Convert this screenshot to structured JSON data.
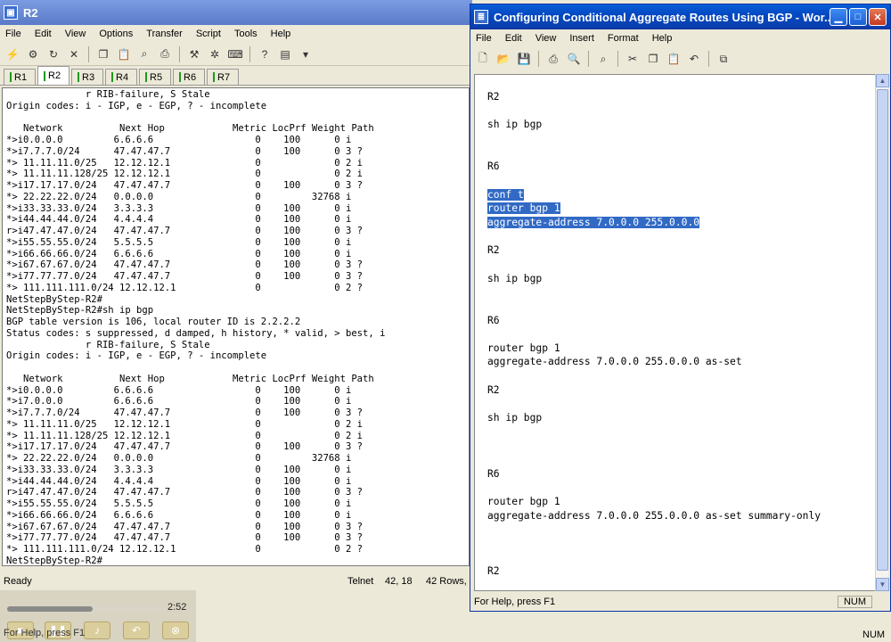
{
  "left_window": {
    "title": "R2",
    "menu": [
      "File",
      "Edit",
      "View",
      "Options",
      "Transfer",
      "Script",
      "Tools",
      "Help"
    ],
    "tabs": [
      "R1",
      "R2",
      "R3",
      "R4",
      "R5",
      "R6",
      "R7"
    ],
    "active_tab": "R2",
    "terminal_lines": [
      "              r RIB-failure, S Stale",
      "Origin codes: i - IGP, e - EGP, ? - incomplete",
      "",
      "   Network          Next Hop            Metric LocPrf Weight Path",
      "*>i0.0.0.0         6.6.6.6                  0    100      0 i",
      "*>i7.7.7.0/24      47.47.47.7               0    100      0 3 ?",
      "*> 11.11.11.0/25   12.12.12.1               0             0 2 i",
      "*> 11.11.11.128/25 12.12.12.1               0             0 2 i",
      "*>i17.17.17.0/24   47.47.47.7               0    100      0 3 ?",
      "*> 22.22.22.0/24   0.0.0.0                  0         32768 i",
      "*>i33.33.33.0/24   3.3.3.3                  0    100      0 i",
      "*>i44.44.44.0/24   4.4.4.4                  0    100      0 i",
      "r>i47.47.47.0/24   47.47.47.7               0    100      0 3 ?",
      "*>i55.55.55.0/24   5.5.5.5                  0    100      0 i",
      "*>i66.66.66.0/24   6.6.6.6                  0    100      0 i",
      "*>i67.67.67.0/24   47.47.47.7               0    100      0 3 ?",
      "*>i77.77.77.0/24   47.47.47.7               0    100      0 3 ?",
      "*> 111.111.111.0/24 12.12.12.1              0             0 2 ?",
      "NetStepByStep-R2#",
      "NetStepByStep-R2#sh ip bgp",
      "BGP table version is 106, local router ID is 2.2.2.2",
      "Status codes: s suppressed, d damped, h history, * valid, > best, i",
      "              r RIB-failure, S Stale",
      "Origin codes: i - IGP, e - EGP, ? - incomplete",
      "",
      "   Network          Next Hop            Metric LocPrf Weight Path",
      "*>i0.0.0.0         6.6.6.6                  0    100      0 i",
      "*>i7.0.0.0         6.6.6.6                  0    100      0 i",
      "*>i7.7.7.0/24      47.47.47.7               0    100      0 3 ?",
      "*> 11.11.11.0/25   12.12.12.1               0             0 2 i",
      "*> 11.11.11.128/25 12.12.12.1               0             0 2 i",
      "*>i17.17.17.0/24   47.47.47.7               0    100      0 3 ?",
      "*> 22.22.22.0/24   0.0.0.0                  0         32768 i",
      "*>i33.33.33.0/24   3.3.3.3                  0    100      0 i",
      "*>i44.44.44.0/24   4.4.4.4                  0    100      0 i",
      "r>i47.47.47.0/24   47.47.47.7               0    100      0 3 ?",
      "*>i55.55.55.0/24   5.5.5.5                  0    100      0 i",
      "*>i66.66.66.0/24   6.6.6.6                  0    100      0 i",
      "*>i67.67.67.0/24   47.47.47.7               0    100      0 3 ?",
      "*>i77.77.77.0/24   47.47.47.7               0    100      0 3 ?",
      "*> 111.111.111.0/24 12.12.12.1              0             0 2 ?",
      "NetStepByStep-R2#"
    ],
    "status_left": "Ready",
    "status_proto": "Telnet",
    "status_pos": "42, 18",
    "status_rows": "42 Rows,"
  },
  "right_window": {
    "title": "Configuring Conditional Aggregate Routes Using BGP - Wor...",
    "menu": [
      "File",
      "Edit",
      "View",
      "Insert",
      "Format",
      "Help"
    ],
    "doc_lines": [
      "R2",
      "",
      "sh ip bgp",
      "",
      "",
      "R6",
      "",
      "conf t",
      "router bgp 1",
      "aggregate-address 7.0.0.0 255.0.0.0",
      "",
      "R2",
      "",
      "sh ip bgp",
      "",
      "",
      "R6",
      "",
      "router bgp 1",
      "aggregate-address 7.0.0.0 255.0.0.0 as-set",
      "",
      "R2",
      "",
      "sh ip bgp",
      "",
      "",
      "",
      "R6",
      "",
      "router bgp 1",
      "aggregate-address 7.0.0.0 255.0.0.0 as-set summary-only",
      "",
      "",
      "",
      "R2"
    ],
    "status_help": "For Help, press F1",
    "status_num": "NUM"
  },
  "video": {
    "time": "2:52",
    "progress": 0.55,
    "help_text": "For Help, press F1",
    "num": "NUM"
  }
}
